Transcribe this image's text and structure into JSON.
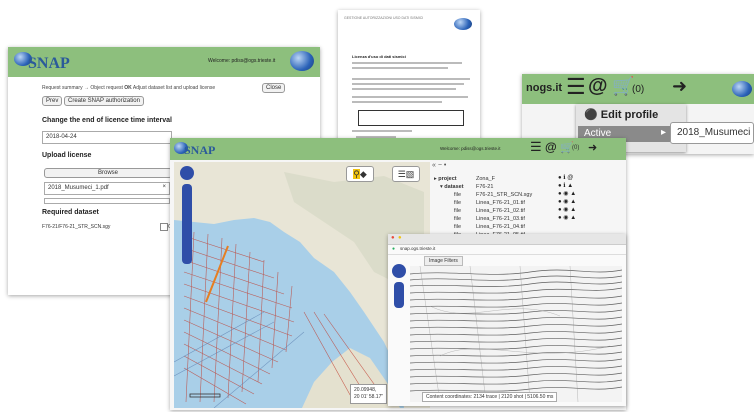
{
  "brand": {
    "name": "SNAP"
  },
  "document": {
    "header_text": "GESTIONE AUTORIZZAZIONI USO DATI SISMICI",
    "title_text": "Licenza d'uso di dati sismici",
    "body_text": "richiesta autorizzazione dataset"
  },
  "request_window": {
    "welcome": "Welcome: pdiss@ogs.trieste.it",
    "breadcrumb": [
      "Request summary",
      "→ Object request",
      "OK",
      "Adjust dataset list and upload license"
    ],
    "close_label": "Close",
    "prev_label": "Prev",
    "create_label": "Create SNAP authorization",
    "change_end_title": "Change the end of licence time interval",
    "date_value": "2018-04-24",
    "upload_title": "Upload license",
    "browse_label": "Browse",
    "file_name": "2018_Musumeci_1.pdf",
    "required_title": "Required dataset",
    "dataset_item": "F76-21/F76-21_STR_SCN.sgy",
    "dataset_suffix": "Ok"
  },
  "account_window": {
    "domain_text": "nogs.it",
    "cart_count": "(0)",
    "menu": [
      {
        "label": "Edit profile",
        "icon": "user-circle-icon"
      },
      {
        "label": "Active",
        "icon": "chevron-right-icon"
      }
    ],
    "selection_value": "2018_Musumeci"
  },
  "map_window": {
    "welcome": "Welcome: pdiss@ogs.trieste.it",
    "cart_count": "(0)",
    "coords": [
      "20.09948,",
      "20 01' 58.17\""
    ],
    "tree": [
      {
        "label": "project",
        "value": "Zona_F"
      },
      {
        "label": "dataset",
        "value": "F76-21"
      },
      {
        "label": "file",
        "value": "F76-21_STR_SCN.sgy"
      },
      {
        "label": "file",
        "value": "Linea_F76-21_01.tif"
      },
      {
        "label": "file",
        "value": "Linea_F76-21_02.tif"
      },
      {
        "label": "file",
        "value": "Linea_F76-21_03.tif"
      },
      {
        "label": "file",
        "value": "Linea_F76-21_04.tif"
      },
      {
        "label": "file",
        "value": "Linea_F76-21_05.tif"
      }
    ]
  },
  "seismic_viewer": {
    "url_host": "snap.ogs.trieste.it",
    "tab_label": "Image Filters",
    "status": "Content coordinates: 2134 trace | 2120 shot | 5106.50 ms"
  },
  "colors": {
    "header_green": "#8dbf7d",
    "brand_blue": "#2b5a9a",
    "seismic_line": "#c0392b",
    "sea": "#a9cfe8"
  }
}
